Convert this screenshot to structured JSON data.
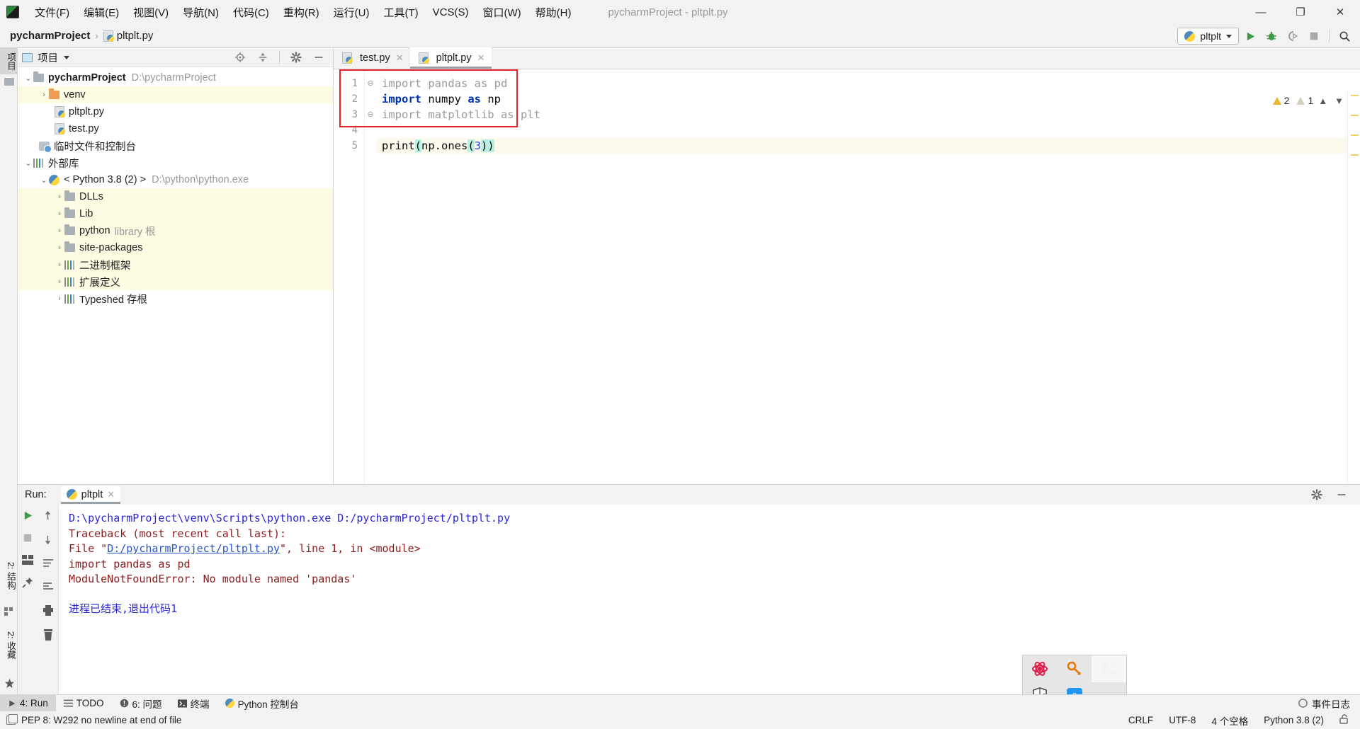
{
  "window": {
    "title": "pycharmProject - pltplt.py",
    "controls": {
      "minimize": "—",
      "maximize": "❐",
      "close": "✕"
    }
  },
  "menu": [
    {
      "label": "文件(F)",
      "key": "F"
    },
    {
      "label": "编辑(E)",
      "key": "E"
    },
    {
      "label": "视图(V)",
      "key": "V"
    },
    {
      "label": "导航(N)",
      "key": "N"
    },
    {
      "label": "代码(C)",
      "key": "C"
    },
    {
      "label": "重构(R)",
      "key": "R"
    },
    {
      "label": "运行(U)",
      "key": "U"
    },
    {
      "label": "工具(T)",
      "key": "T"
    },
    {
      "label": "VCS(S)",
      "key": "S"
    },
    {
      "label": "窗口(W)",
      "key": "W"
    },
    {
      "label": "帮助(H)",
      "key": "H"
    }
  ],
  "breadcrumb": {
    "project": "pycharmProject",
    "separator": "›",
    "file": "pltplt.py"
  },
  "toolbar": {
    "run_config": "pltplt",
    "run_icon": "run-triangle-icon",
    "debug_icon": "debug-bug-icon",
    "coverage_icon": "coverage-icon",
    "stop_icon": "stop-square-icon",
    "search_icon": "search-magnifier-icon"
  },
  "left_strip": {
    "project_tab": "项目",
    "structure_tab": "2: 结构",
    "favorites_tab": "2: 收藏"
  },
  "project_panel": {
    "title": "项目",
    "tools": [
      "locate-icon",
      "collapse-all-icon",
      "settings-gear-icon",
      "hide-icon"
    ],
    "tree": [
      {
        "indent": 0,
        "arrow": "⌄",
        "icon": "folder-icon",
        "label": "pycharmProject",
        "detail": "D:\\pycharmProject",
        "bold": true,
        "lib": false
      },
      {
        "indent": 1,
        "arrow": "›",
        "icon": "folder-orange-icon",
        "label": "venv",
        "detail": "",
        "bold": false,
        "lib": true
      },
      {
        "indent": 2,
        "arrow": "",
        "icon": "python-file-icon",
        "label": "pltplt.py",
        "detail": "",
        "bold": false,
        "lib": false
      },
      {
        "indent": 2,
        "arrow": "",
        "icon": "python-file-icon",
        "label": "test.py",
        "detail": "",
        "bold": false,
        "lib": false
      },
      {
        "indent": 1,
        "arrow": "",
        "icon": "scratches-icon",
        "label": "临时文件和控制台",
        "detail": "",
        "bold": false,
        "lib": false
      },
      {
        "indent": 0,
        "arrow": "⌄",
        "icon": "library-bars-icon",
        "label": "外部库",
        "detail": "",
        "bold": false,
        "lib": false
      },
      {
        "indent": 1,
        "arrow": "⌄",
        "icon": "python-sdk-icon",
        "label": "< Python 3.8 (2) >",
        "detail": "D:\\python\\python.exe",
        "bold": false,
        "lib": false
      },
      {
        "indent": 2,
        "arrow": "›",
        "icon": "folder-icon",
        "label": "DLLs",
        "detail": "",
        "bold": false,
        "lib": true
      },
      {
        "indent": 2,
        "arrow": "›",
        "icon": "folder-icon",
        "label": "Lib",
        "detail": "",
        "bold": false,
        "lib": true
      },
      {
        "indent": 2,
        "arrow": "›",
        "icon": "folder-icon",
        "label": "python",
        "detail": "library 根",
        "bold": false,
        "lib": true
      },
      {
        "indent": 2,
        "arrow": "›",
        "icon": "folder-icon",
        "label": "site-packages",
        "detail": "",
        "bold": false,
        "lib": true
      },
      {
        "indent": 2,
        "arrow": "›",
        "icon": "library-bars-icon",
        "label": "二进制框架",
        "detail": "",
        "bold": false,
        "lib": true
      },
      {
        "indent": 2,
        "arrow": "›",
        "icon": "library-bars-icon",
        "label": "扩展定义",
        "detail": "",
        "bold": false,
        "lib": true
      },
      {
        "indent": 2,
        "arrow": "›",
        "icon": "library-bars-icon",
        "label": "Typeshed 存根",
        "detail": "",
        "bold": false,
        "lib": false
      }
    ]
  },
  "editor": {
    "tabs": [
      {
        "label": "test.py",
        "active": false,
        "close": "✕"
      },
      {
        "label": "pltplt.py",
        "active": true,
        "close": "✕"
      }
    ],
    "line_numbers": [
      "1",
      "2",
      "3",
      "4",
      "5"
    ],
    "code_lines": [
      {
        "n": 1,
        "text": "import pandas as pd",
        "style": "grey",
        "fold": "⊖"
      },
      {
        "n": 2,
        "text": "import numpy as np",
        "style": "kw",
        "fold": ""
      },
      {
        "n": 3,
        "text": "import matplotlib as plt",
        "style": "grey",
        "fold": "⊖"
      },
      {
        "n": 4,
        "text": "",
        "style": "plain",
        "fold": ""
      },
      {
        "n": 5,
        "text": "print(np.ones(3))",
        "style": "print",
        "fold": ""
      }
    ],
    "inspections": {
      "warning_count": "2",
      "weak_warning_count": "1",
      "prev_icon": "chevron-up-icon",
      "next_icon": "chevron-down-icon"
    }
  },
  "run_panel": {
    "label": "Run:",
    "tab": "pltplt",
    "tab_close": "✕",
    "tools_left": [
      "rerun-icon",
      "stop-icon",
      "layout-icon",
      "pin-icon"
    ],
    "tools_right": [
      "scroll-up-icon",
      "scroll-down-icon",
      "soft-wrap-icon",
      "scroll-to-end-icon",
      "print-icon",
      "clear-all-icon"
    ],
    "header_right": [
      "settings-gear-icon",
      "hide-icon"
    ],
    "console": [
      {
        "text": "D:\\pycharmProject\\venv\\Scripts\\python.exe D:/pycharmProject/pltplt.py",
        "kind": "cmd"
      },
      {
        "text": "Traceback (most recent call last):",
        "kind": "err"
      },
      {
        "text": "  File \"D:/pycharmProject/pltplt.py\", line 1, in <module>",
        "kind": "file",
        "link": "D:/pycharmProject/pltplt.py"
      },
      {
        "text": "    import pandas as pd",
        "kind": "err"
      },
      {
        "text": "ModuleNotFoundError: No module named 'pandas'",
        "kind": "err"
      },
      {
        "text": "",
        "kind": "blank"
      },
      {
        "text": "进程已结束,退出代码1",
        "kind": "cmd"
      }
    ]
  },
  "tool_windows": {
    "items": [
      {
        "label": "4: Run",
        "icon": "run-triangle-icon",
        "active": true
      },
      {
        "label": "TODO",
        "icon": "todo-list-icon",
        "active": false
      },
      {
        "label": "6: 问题",
        "icon": "problems-icon",
        "active": false
      },
      {
        "label": "终端",
        "icon": "terminal-icon",
        "active": false
      },
      {
        "label": "Python 控制台",
        "icon": "python-console-icon",
        "active": false
      }
    ],
    "event_log": "事件日志",
    "event_log_icon": "event-log-icon"
  },
  "status_bar": {
    "message": "PEP 8: W292 no newline at end of file",
    "message_icon": "inspection-copy-icon",
    "line_sep": "CRLF",
    "encoding": "UTF-8",
    "indent": "4 个空格",
    "interpreter": "Python 3.8 (2)",
    "lock_icon": "unlocked-padlock-icon"
  },
  "tray_popup": {
    "icons": [
      "atom-red-icon",
      "key-orange-icon",
      "windows-flag-icon",
      "shield-warning-icon",
      "app-blue-icon"
    ]
  }
}
